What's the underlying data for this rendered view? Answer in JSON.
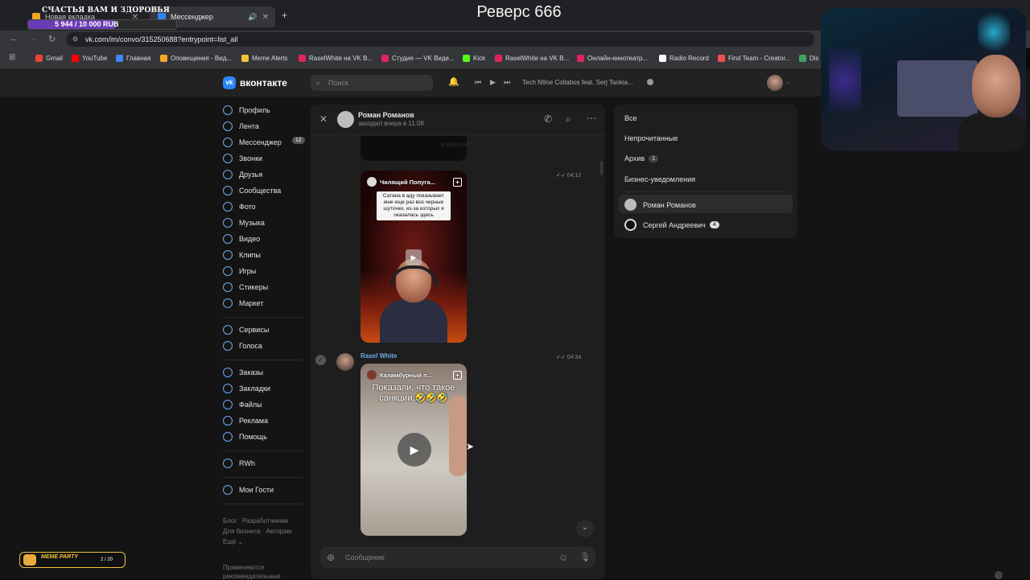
{
  "overlay": {
    "donation_title": "СЧАСТЬЯ ВАМ И ЗДОРОВЬЯ",
    "donation_amount": "5 944 / 10 000 RUB",
    "donation_progress": 0.5944,
    "stream_title": "Реверс 666",
    "meme_party_label": "MEME PARTY",
    "meme_party_count": "2 / 20"
  },
  "browser": {
    "tabs": [
      {
        "label": "Новая вкладка",
        "icon": "yellow-favicon"
      },
      {
        "label": "Мессенджер",
        "icon": "vk-favicon"
      }
    ],
    "url": "vk.com/im/convo/315250688?entrypoint=list_all",
    "bookmarks": [
      {
        "label": "Gmail",
        "color": "#ea4335"
      },
      {
        "label": "YouTube",
        "color": "#ff0000"
      },
      {
        "label": "Главная",
        "color": "#4285f4"
      },
      {
        "label": "Оповещения - Вид...",
        "color": "#f5a623"
      },
      {
        "label": "Meme Alerts",
        "color": "#f2c23a"
      },
      {
        "label": "RaselWhite на VK В...",
        "color": "#e0245e"
      },
      {
        "label": "Студия — VK Виде...",
        "color": "#e0245e"
      },
      {
        "label": "Kick",
        "color": "#53fc18"
      },
      {
        "label": "RaselWhite на VK В...",
        "color": "#e0245e"
      },
      {
        "label": "Онлайн-кинотеатр...",
        "color": "#e0245e"
      },
      {
        "label": "Radio Record",
        "color": "#ffffff"
      },
      {
        "label": "Find Team - Creator...",
        "color": "#f04e4e"
      },
      {
        "label": "Dis",
        "color": "#3ba55d"
      }
    ]
  },
  "vk": {
    "logo": "вконтакте",
    "search_placeholder": "Поиск",
    "now_playing": "Tech N9ne Collabos feat. Serj Tankia...",
    "nav": [
      {
        "label": "Профиль"
      },
      {
        "label": "Лента"
      },
      {
        "label": "Мессенджер",
        "badge": "12"
      },
      {
        "label": "Звонки"
      },
      {
        "label": "Друзья"
      },
      {
        "label": "Сообщества"
      },
      {
        "label": "Фото"
      },
      {
        "label": "Музыка"
      },
      {
        "label": "Видео"
      },
      {
        "label": "Клипы"
      },
      {
        "label": "Игры"
      },
      {
        "label": "Стикеры"
      },
      {
        "label": "Маркет"
      },
      {
        "label": "Сервисы"
      },
      {
        "label": "Голоса"
      },
      {
        "label": "Заказы"
      },
      {
        "label": "Закладки"
      },
      {
        "label": "Файлы"
      },
      {
        "label": "Реклама"
      },
      {
        "label": "Помощь"
      },
      {
        "label": "RWh"
      },
      {
        "label": "Мои Гости"
      }
    ],
    "footer": {
      "l1": "Блог",
      "l2": "Разработчикам",
      "l3": "Для бизнеса",
      "l4": "Авторам",
      "l5": "Ещё",
      "rec1": "Применяются",
      "rec2": "рекомендательные"
    }
  },
  "chat": {
    "name": "Роман Романов",
    "status": "заходил вчера в 11:08",
    "partial_caption": "о сексуал",
    "messages": [
      {
        "time": "04:12",
        "video_title": "Чилящий Попуга...",
        "caption": "Сатана в аду показывает мне еще раз все черные шуточки, из-за которых я оказалась здесь"
      },
      {
        "sender": "Rasel White",
        "time": "04:34",
        "video_title": "Каламбурный п...",
        "caption": "Показали, что такое санкции.🤣🤣🤣"
      }
    ],
    "input_placeholder": "Сообщение"
  },
  "folders": {
    "all": "Все",
    "unread": "Непрочитанные",
    "archive": "Архив",
    "archive_count": "1",
    "business": "Бизнес-уведомления",
    "conversations": [
      {
        "name": "Роман Романов"
      },
      {
        "name": "Сергей Андреевич",
        "count": "4"
      }
    ]
  }
}
